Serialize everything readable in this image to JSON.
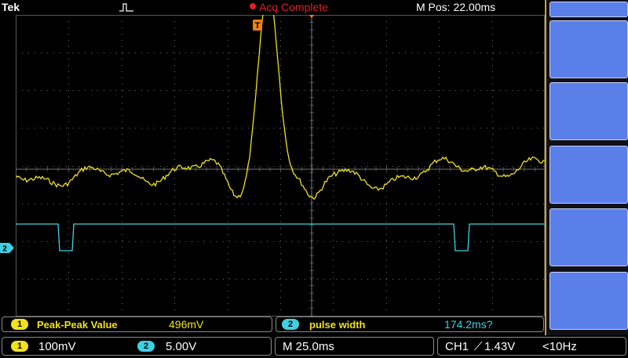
{
  "header": {
    "brand": "Tek",
    "acq_status": "Acq Complete",
    "m_pos": "M Pos: 22.00ms",
    "trigger_marker": "T"
  },
  "channels": {
    "ch1_color": "#f0e020",
    "ch2_color": "#40d0e0",
    "ch2_marker": "2"
  },
  "measurements": [
    {
      "channel": "1",
      "label": "Peak-Peak Value",
      "value": "496mV"
    },
    {
      "channel": "2",
      "label": "pulse width",
      "value": "174.2ms?"
    }
  ],
  "status_bar": {
    "ch1_channel": "1",
    "ch1_scale": "100mV",
    "ch2_channel": "2",
    "ch2_scale": "5.00V",
    "timebase": "M 25.0ms",
    "trigger_ch": "CH1",
    "trigger_symbol": "⟋",
    "trigger_level": "1.43V",
    "trigger_freq": "<10Hz"
  }
}
